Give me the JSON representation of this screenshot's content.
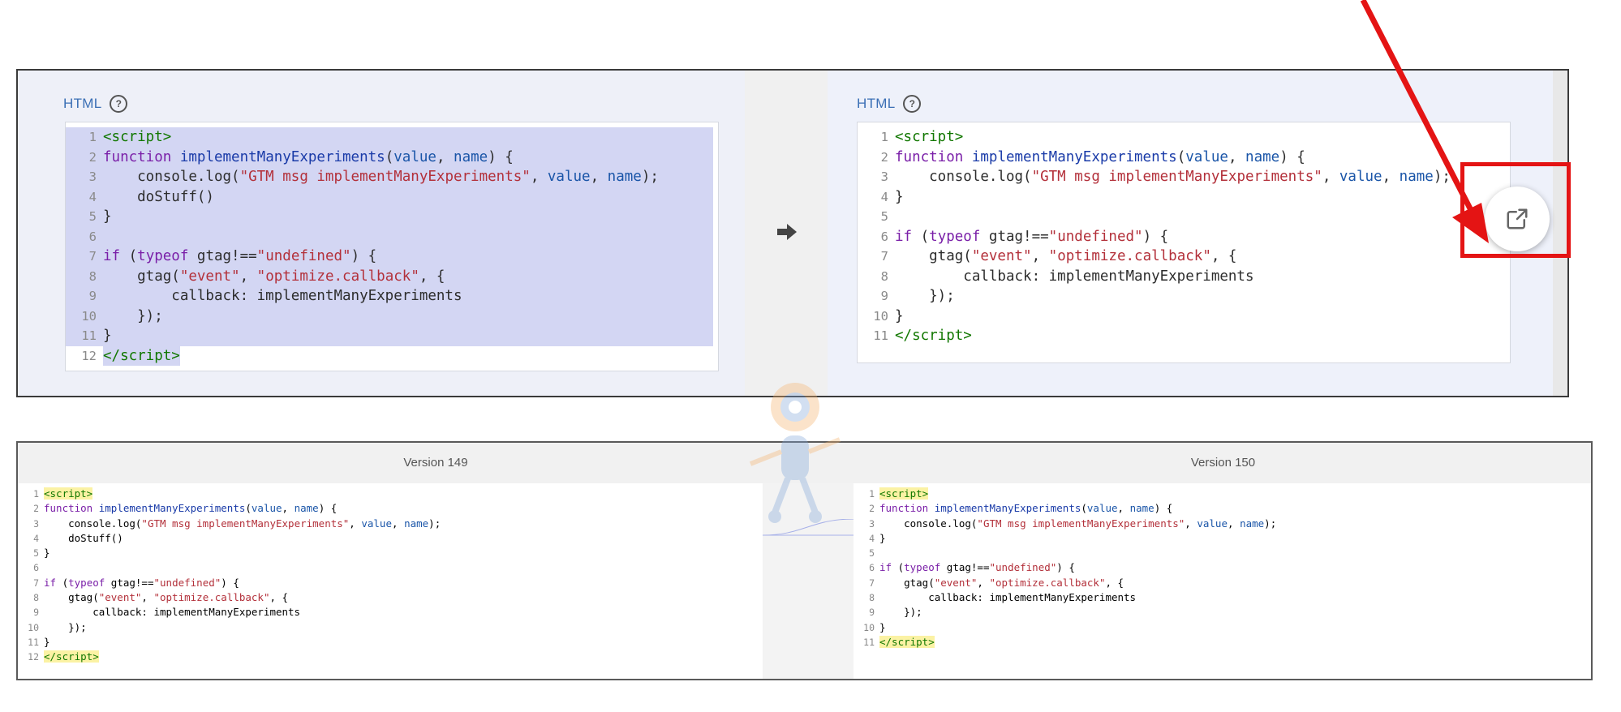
{
  "top_panel": {
    "left_label": "HTML",
    "right_label": "HTML",
    "left_code": [
      {
        "n": "1",
        "html": "<span class='tok-tag'>&lt;script&gt;</span>"
      },
      {
        "n": "2",
        "html": "<span class='tok-kw'>function</span> <span class='tok-fn'>implementManyExperiments</span>(<span class='tok-var'>value</span>, <span class='tok-var'>name</span>) {"
      },
      {
        "n": "3",
        "html": "    console.log(<span class='tok-str'>\"GTM msg implementManyExperiments\"</span>, <span class='tok-var'>value</span>, <span class='tok-var'>name</span>);"
      },
      {
        "n": "4",
        "html": "    doStuff()"
      },
      {
        "n": "5",
        "html": "}"
      },
      {
        "n": "6",
        "html": ""
      },
      {
        "n": "7",
        "html": "<span class='tok-kw'>if</span> (<span class='tok-kw'>typeof</span> gtag!==<span class='tok-str'>\"undefined\"</span>) {"
      },
      {
        "n": "8",
        "html": "    gtag(<span class='tok-str'>\"event\"</span>, <span class='tok-str'>\"optimize.callback\"</span>, {"
      },
      {
        "n": "9",
        "html": "        callback: implementManyExperiments"
      },
      {
        "n": "10",
        "html": "    });"
      },
      {
        "n": "11",
        "html": "}"
      },
      {
        "n": "12",
        "html": "<span class='tok-tag'>&lt;/script&gt;</span>"
      }
    ],
    "right_code": [
      {
        "n": "1",
        "html": "<span class='tok-tag'>&lt;script&gt;</span>"
      },
      {
        "n": "2",
        "html": "<span class='tok-kw'>function</span> <span class='tok-fn'>implementManyExperiments</span>(<span class='tok-var'>value</span>, <span class='tok-var'>name</span>) {"
      },
      {
        "n": "3",
        "html": "    console.log(<span class='tok-str'>\"GTM msg implementManyExperiments\"</span>, <span class='tok-var'>value</span>, <span class='tok-var'>name</span>);"
      },
      {
        "n": "4",
        "html": "}"
      },
      {
        "n": "5",
        "html": ""
      },
      {
        "n": "6",
        "html": "<span class='tok-kw'>if</span> (<span class='tok-kw'>typeof</span> gtag!==<span class='tok-str'>\"undefined\"</span>) {"
      },
      {
        "n": "7",
        "html": "    gtag(<span class='tok-str'>\"event\"</span>, <span class='tok-str'>\"optimize.callback\"</span>, {"
      },
      {
        "n": "8",
        "html": "        callback: implementManyExperiments"
      },
      {
        "n": "9",
        "html": "    });"
      },
      {
        "n": "10",
        "html": "}"
      },
      {
        "n": "11",
        "html": "<span class='tok-tag'>&lt;/script&gt;</span>"
      }
    ]
  },
  "bottom_panel": {
    "left_header": "Version 149",
    "right_header": "Version 150",
    "left_code": [
      {
        "n": "1",
        "html": "<span class='tok-tag tag-hl'>&lt;script&gt;</span>"
      },
      {
        "n": "2",
        "html": "<span class='tok-kw'>function</span> <span class='tok-fn'>implementManyExperiments</span>(<span class='tok-var'>value</span>, <span class='tok-var'>name</span>) {"
      },
      {
        "n": "3",
        "html": "    console.log(<span class='tok-str'>\"GTM msg implementManyExperiments\"</span>, <span class='tok-var'>value</span>, <span class='tok-var'>name</span>);"
      },
      {
        "n": "4",
        "html": "    doStuff()"
      },
      {
        "n": "5",
        "html": "}"
      },
      {
        "n": "6",
        "html": ""
      },
      {
        "n": "7",
        "html": "<span class='tok-kw'>if</span> (<span class='tok-kw'>typeof</span> gtag!==<span class='tok-str'>\"undefined\"</span>) {"
      },
      {
        "n": "8",
        "html": "    gtag(<span class='tok-str'>\"event\"</span>, <span class='tok-str'>\"optimize.callback\"</span>, {"
      },
      {
        "n": "9",
        "html": "        callback: implementManyExperiments"
      },
      {
        "n": "10",
        "html": "    });"
      },
      {
        "n": "11",
        "html": "}"
      },
      {
        "n": "12",
        "html": "<span class='tok-tag tag-hl'>&lt;/script&gt;</span>"
      }
    ],
    "right_code": [
      {
        "n": "1",
        "html": "<span class='tok-tag tag-hl'>&lt;script&gt;</span>"
      },
      {
        "n": "2",
        "html": "<span class='tok-kw'>function</span> <span class='tok-fn'>implementManyExperiments</span>(<span class='tok-var'>value</span>, <span class='tok-var'>name</span>) {"
      },
      {
        "n": "3",
        "html": "    console.log(<span class='tok-str'>\"GTM msg implementManyExperiments\"</span>, <span class='tok-var'>value</span>, <span class='tok-var'>name</span>);"
      },
      {
        "n": "4",
        "html": "}"
      },
      {
        "n": "5",
        "html": ""
      },
      {
        "n": "6",
        "html": "<span class='tok-kw'>if</span> (<span class='tok-kw'>typeof</span> gtag!==<span class='tok-str'>\"undefined\"</span>) {"
      },
      {
        "n": "7",
        "html": "    gtag(<span class='tok-str'>\"event\"</span>, <span class='tok-str'>\"optimize.callback\"</span>, {"
      },
      {
        "n": "8",
        "html": "        callback: implementManyExperiments"
      },
      {
        "n": "9",
        "html": "    });"
      },
      {
        "n": "10",
        "html": "}"
      },
      {
        "n": "11",
        "html": "<span class='tok-tag tag-hl'>&lt;/script&gt;</span>"
      }
    ]
  },
  "icons": {
    "help": "question-circle-icon",
    "arrow": "arrow-right-icon",
    "open": "open-in-new-icon"
  },
  "colors": {
    "selection": "#d3d6f3",
    "annotation_red": "#e41414",
    "label_blue": "#3b6fb5"
  }
}
